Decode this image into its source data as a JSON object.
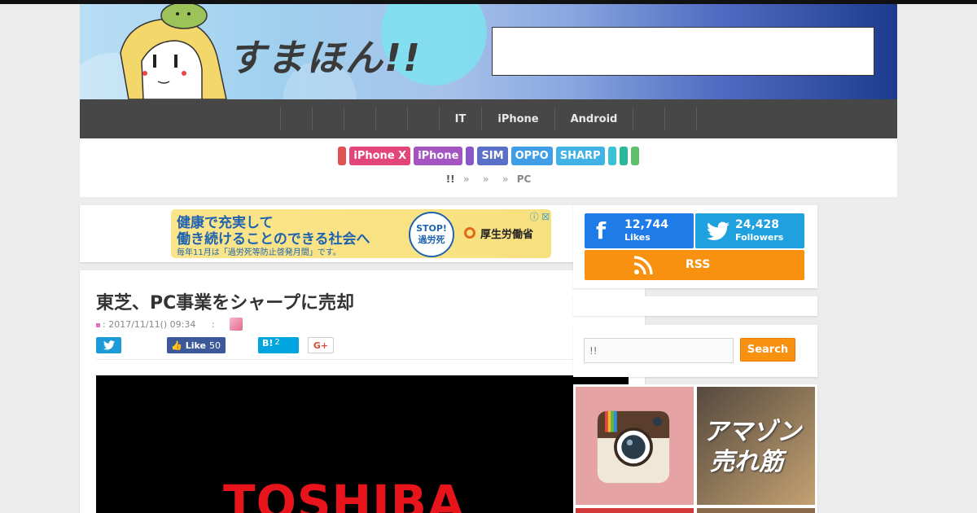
{
  "site": {
    "logo_text": "すまほん!!"
  },
  "nav": {
    "items": [
      "",
      "",
      "",
      "",
      "",
      "IT",
      "iPhone",
      "Android",
      "",
      ""
    ]
  },
  "tags": [
    {
      "label": "",
      "color": "#e05252"
    },
    {
      "label": "iPhone X",
      "color": "#e2457a"
    },
    {
      "label": "iPhone",
      "color": "#a455c2"
    },
    {
      "label": "",
      "color": "#8a58c4"
    },
    {
      "label": "SIM",
      "color": "#5a6fc8"
    },
    {
      "label": "OPPO",
      "color": "#3f9ee6"
    },
    {
      "label": "SHARP",
      "color": "#40b2e6"
    },
    {
      "label": "",
      "color": "#3cc2d6"
    },
    {
      "label": "",
      "color": "#2ab89a"
    },
    {
      "label": "",
      "color": "#5ec16a"
    }
  ],
  "breadcrumb": {
    "home": "!!",
    "sep": "»",
    "current": "PC"
  },
  "ad_banner": {
    "line1": "健康で充実して",
    "line2": "働き続けることのできる社会へ",
    "line3": "毎年11月は「過労死等防止啓発月間」です。",
    "badge_line1": "STOP!",
    "badge_line2": "過労死",
    "ministry": "厚生労働省",
    "adchoice": "ⓘ ☒"
  },
  "post": {
    "title": "東芝、PC事業をシャープに売却",
    "meta_date": ": 2017/11/11() 09:34",
    "meta_author_sep": ":",
    "share": {
      "like_label": "Like",
      "like_count": "50",
      "hatena_label": "B!",
      "hatena_count": "2",
      "gplus_label": "G+"
    },
    "image_text": "TOSHIBA"
  },
  "follow": {
    "facebook": {
      "count": "12,744",
      "label": "Likes"
    },
    "twitter": {
      "count": "24,428",
      "label": "Followers"
    },
    "rss": {
      "label": "RSS"
    }
  },
  "search": {
    "placeholder": "!!",
    "button": "Search"
  },
  "sidebar_banners": {
    "amazon_line1": "アマゾン",
    "amazon_line2": "売れ筋"
  },
  "colors": {
    "nav_bg": "#474747",
    "facebook": "#1e7be8",
    "twitter": "#1ea1de",
    "rss": "#f7910f",
    "accent": "#f7910f"
  }
}
